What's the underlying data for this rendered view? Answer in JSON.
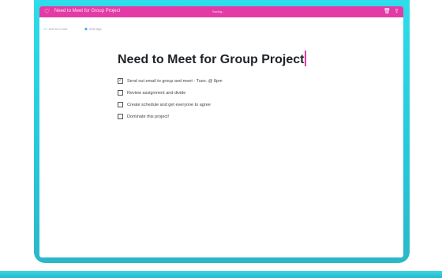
{
  "titlebar": {
    "title": "Need to Meet for Group Project",
    "status": "Saving...",
    "heart_icon": "heart-icon",
    "trash_icon": "trash-icon",
    "share_icon": "share-icon"
  },
  "meta": {
    "notebook": "Add to a note",
    "tags": "Add tags"
  },
  "note": {
    "title": "Need to Meet for Group Project",
    "items": [
      {
        "checked": true,
        "text": "Send out email to group and meet - Tues. @ 8pm"
      },
      {
        "checked": false,
        "text": "Review assignment and divide"
      },
      {
        "checked": false,
        "text": "Create schedule and get everyone to agree"
      },
      {
        "checked": false,
        "text": "Dominate this project!"
      }
    ]
  },
  "colors": {
    "titlebar": "#e33aa6",
    "frame": "#2fdce9",
    "caret": "#e33aa6"
  }
}
